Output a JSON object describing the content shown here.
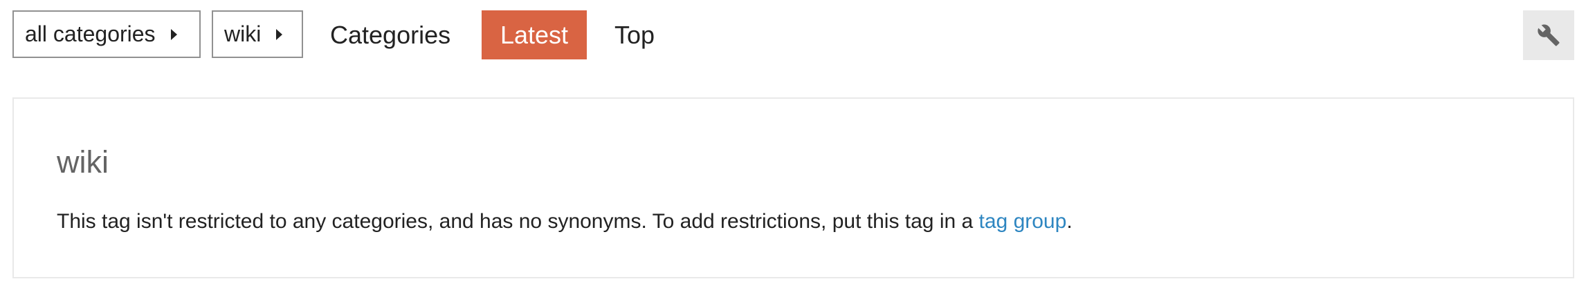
{
  "filters": {
    "category_dropdown_label": "all categories",
    "tag_dropdown_label": "wiki"
  },
  "nav": {
    "items": [
      {
        "label": "Categories",
        "active": false
      },
      {
        "label": "Latest",
        "active": true
      },
      {
        "label": "Top",
        "active": false
      }
    ]
  },
  "toolbar": {
    "admin_icon": "wrench-icon"
  },
  "tag_info": {
    "title": "wiki",
    "description_prefix": "This tag isn't restricted to any categories, and has no synonyms. To add restrictions, put this tag in a ",
    "link_text": "tag group",
    "description_suffix": "."
  },
  "colors": {
    "accent": "#d96443",
    "link": "#2e86c1",
    "muted_text": "#646464",
    "border": "#e9e9e9"
  }
}
